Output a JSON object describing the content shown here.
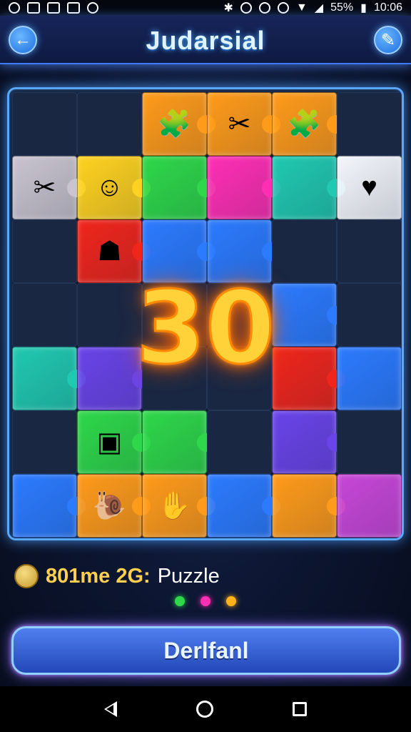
{
  "status_bar": {
    "battery_text": "55%",
    "time": "10:06"
  },
  "header": {
    "title": "Judarsial",
    "back_icon": "arrow-left-icon",
    "tool_icon": "wrench-icon"
  },
  "board": {
    "big_score": "30",
    "colors": {
      "yellow": "#ffd21f",
      "orange": "#ff9b1a",
      "green": "#2fd84a",
      "magenta": "#ff2fb4",
      "teal": "#21c9b0",
      "blue": "#2c7bff",
      "red": "#f0261c",
      "purple": "#6a44e8",
      "grey": "#c9c4cf",
      "white": "#f4f6fb",
      "pink": "#c847d8",
      "dark": "#1a2742"
    }
  },
  "info": {
    "coin_icon": "coin-icon",
    "count_text": "801me 2G:",
    "label": "Puzzle"
  },
  "page_dots": [
    {
      "color": "#2fd84a"
    },
    {
      "color": "#ff2fb4"
    },
    {
      "color": "#ffb21a"
    }
  ],
  "main_button": {
    "label": "Derlfanl"
  },
  "nav_bar": {
    "back_icon": "nav-back-icon",
    "home_icon": "nav-home-icon",
    "recent_icon": "nav-recent-icon"
  }
}
